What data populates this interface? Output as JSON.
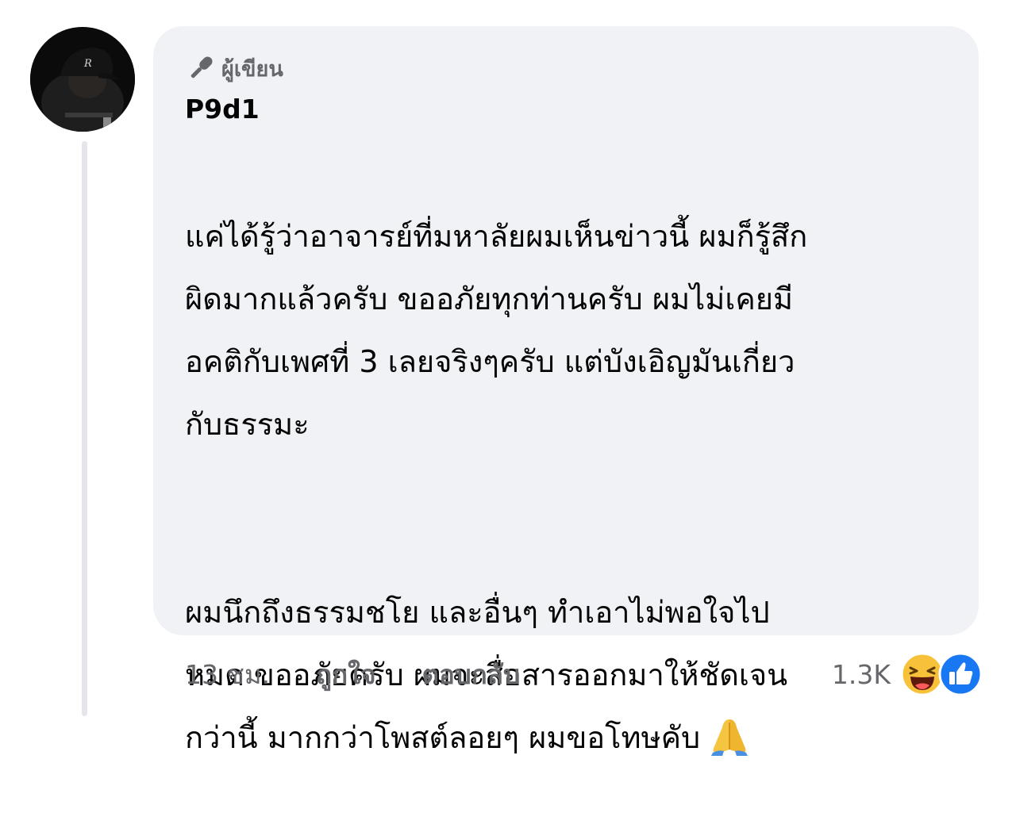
{
  "comment": {
    "author_badge": "ผู้เขียน",
    "author_name": "P9d1",
    "paragraphs": [
      "แค่ได้รู้ว่าอาจารย์ที่มหาลัยผมเห็นข่าวนี้ ผมก็รู้สึก\nผิดมากแล้วครับ ขออภัยทุกท่านครับ ผมไม่เคยมี\nอคติกับเพศที่ 3 เลยจริงๆครับ แต่บังเอิญมันเกี่ยว\nกับธรรมะ",
      "ผมนึกถึงธรรมชโย และอื่นๆ ทำเอาไม่พอใจไป\nหมด ขออภัยครับ ผมจะสื่อสารออกมาให้ชัดเจน\nกว่านี้ มากกว่าโพสต์ลอยๆ ผมขอโทษคับ"
    ],
    "timestamp": "13 ชม.",
    "like_label": "ถูกใจ",
    "reply_label": "ตอบกลับ",
    "reaction_count": "1.3K",
    "reaction_icons": [
      "haha-icon",
      "like-icon"
    ]
  },
  "colors": {
    "bubble_background": "#f0f2f5",
    "secondary_text": "#65676b",
    "primary_text": "#050505",
    "like_blue": "#1877f2",
    "haha_yellow": "#f7c23a"
  }
}
